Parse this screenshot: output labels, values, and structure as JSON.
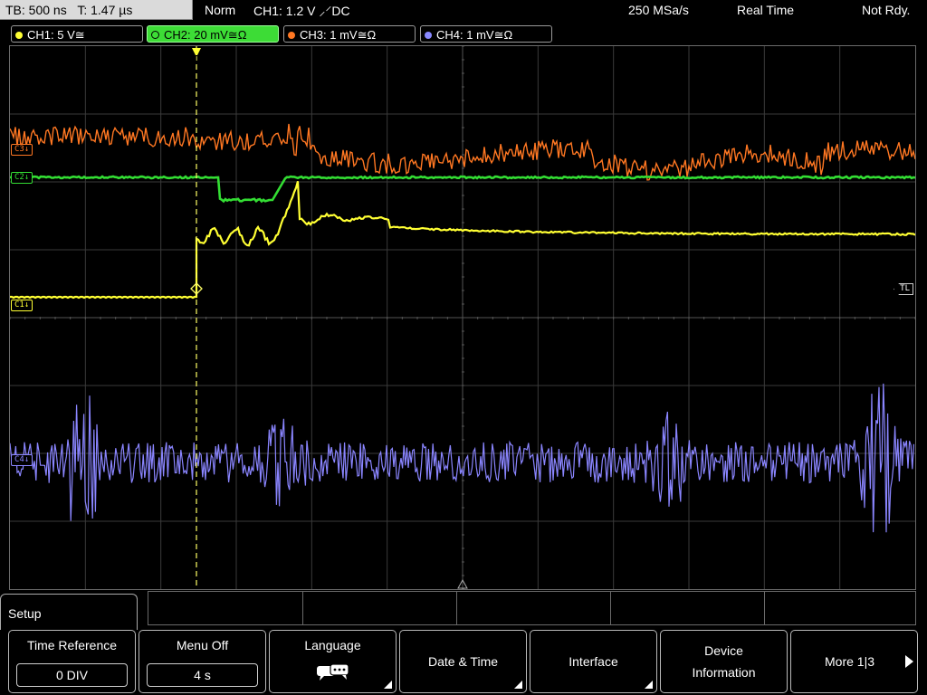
{
  "topbar": {
    "timebase": "TB: 500 ns",
    "trigger_time": "T: 1.47 µs",
    "mode": "Norm",
    "trigger_setting": "CH1: 1.2 V ⸝⸍DC",
    "sample_rate": "250 MSa/s",
    "acq_mode": "Real Time",
    "status": "Not Rdy."
  },
  "channels": [
    {
      "label": "CH1: 5 V≅",
      "color": "#ffff33",
      "active": false
    },
    {
      "label": "CH2: 20 mV≅Ω",
      "color": "#33cc33",
      "active": true
    },
    {
      "label": "CH3: 1 mV≅Ω",
      "color": "#ff7722",
      "active": false
    },
    {
      "label": "CH4: 1 mV≅Ω",
      "color": "#8888ff",
      "active": false
    }
  ],
  "display": {
    "markers": {
      "ch1": "C1↓",
      "ch2": "C2↓",
      "ch3": "C3↓",
      "ch4": "C4↓",
      "trigger_level": "TL",
      "trigger_position": "T"
    }
  },
  "menu": {
    "section_title": "Setup",
    "softkeys": [
      {
        "label": "Time Reference",
        "value": "0 DIV"
      },
      {
        "label": "Menu Off",
        "value": "4 s"
      },
      {
        "label": "Language",
        "icon": "speech-bubbles-icon"
      },
      {
        "label": "Date & Time"
      },
      {
        "label": "Interface"
      },
      {
        "label": "Device Information",
        "line1": "Device",
        "line2": "Information"
      },
      {
        "label": "More 1|3"
      }
    ]
  }
}
